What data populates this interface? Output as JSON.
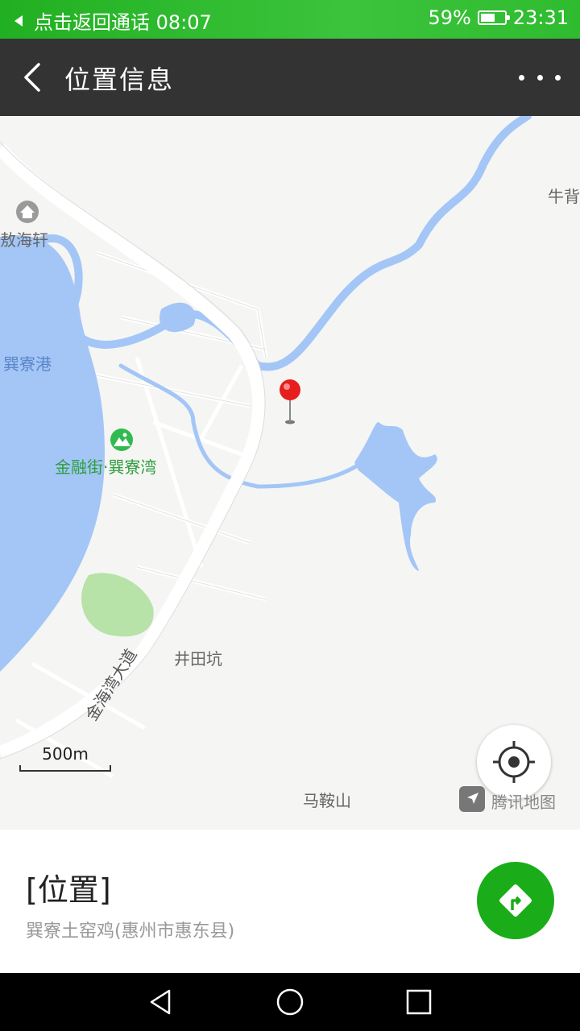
{
  "status_bar": {
    "return_call_text": "点击返回通话 08:07",
    "battery_percent": "59%",
    "time": "23:31",
    "battery_level": 0.59
  },
  "header": {
    "title": "位置信息",
    "back_icon": "chevron-left-icon",
    "more_icon": "more-dots-icon"
  },
  "map": {
    "labels": {
      "niubei": "牛背",
      "aohaixuan": "敖海轩",
      "xunliaogang": "巽寮港",
      "jinrongjie": "金融街·巽寮湾",
      "jingtiankeng": "井田坑",
      "maanshan": "马鞍山",
      "road": "金海湾大道"
    },
    "scale": "500m",
    "provider": "腾讯地图",
    "colors": {
      "water": "#a3c6f7",
      "park": "#b7e2a8",
      "pin": "#e61e1e",
      "land": "#f5f5f3"
    }
  },
  "place": {
    "title": "[位置]",
    "address": "巽寮土窑鸡(惠州市惠东县)"
  },
  "colors": {
    "status_bar": "#2fbb2f",
    "title_bar": "#333333",
    "nav_button": "#1aad19"
  }
}
